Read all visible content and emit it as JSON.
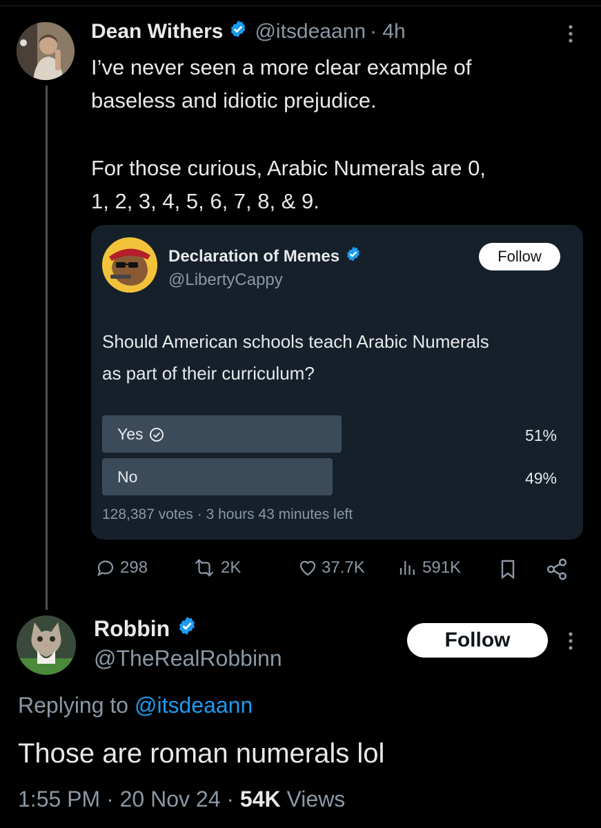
{
  "main_tweet": {
    "name": "Dean Withers",
    "handle": "@itsdeaann",
    "time": "· 4h",
    "text_p1": "I’ve never seen a more clear example of\nbaseless and idiotic prejudice.",
    "text_p2": "For those curious, Arabic Numerals are 0,\n1, 2, 3, 4, 5, 6, 7, 8, & 9."
  },
  "quote": {
    "name": "Declaration of Memes",
    "handle": "@LibertyCappy",
    "follow_label": "Follow",
    "question": "Should American schools teach Arabic Numerals\nas part of their curriculum?",
    "poll": {
      "options": [
        {
          "label": "Yes",
          "percent_text": "51%",
          "percent": 51,
          "winner": true
        },
        {
          "label": "No",
          "percent_text": "49%",
          "percent": 49,
          "winner": false
        }
      ],
      "meta": "128,387 votes · 3 hours 43 minutes left"
    }
  },
  "actions": {
    "replies": "298",
    "reposts": "2K",
    "likes": "37.7K",
    "views": "591K"
  },
  "reply": {
    "name": "Robbin",
    "handle": "@TheRealRobbinn",
    "follow_label": "Follow",
    "replying_prefix": "Replying to",
    "replying_to": "@itsdeaann",
    "text": "Those are roman numerals lol",
    "time_date": "1:55 PM · 20 Nov 24 ·",
    "views_count": "54K",
    "views_label": "Views"
  },
  "colors": {
    "background": "#000000",
    "card": "#15202b",
    "poll_bar": "#3c4b5a",
    "verified": "#1d9bf0",
    "link": "#1d9bf0",
    "muted": "#8b98a5"
  }
}
